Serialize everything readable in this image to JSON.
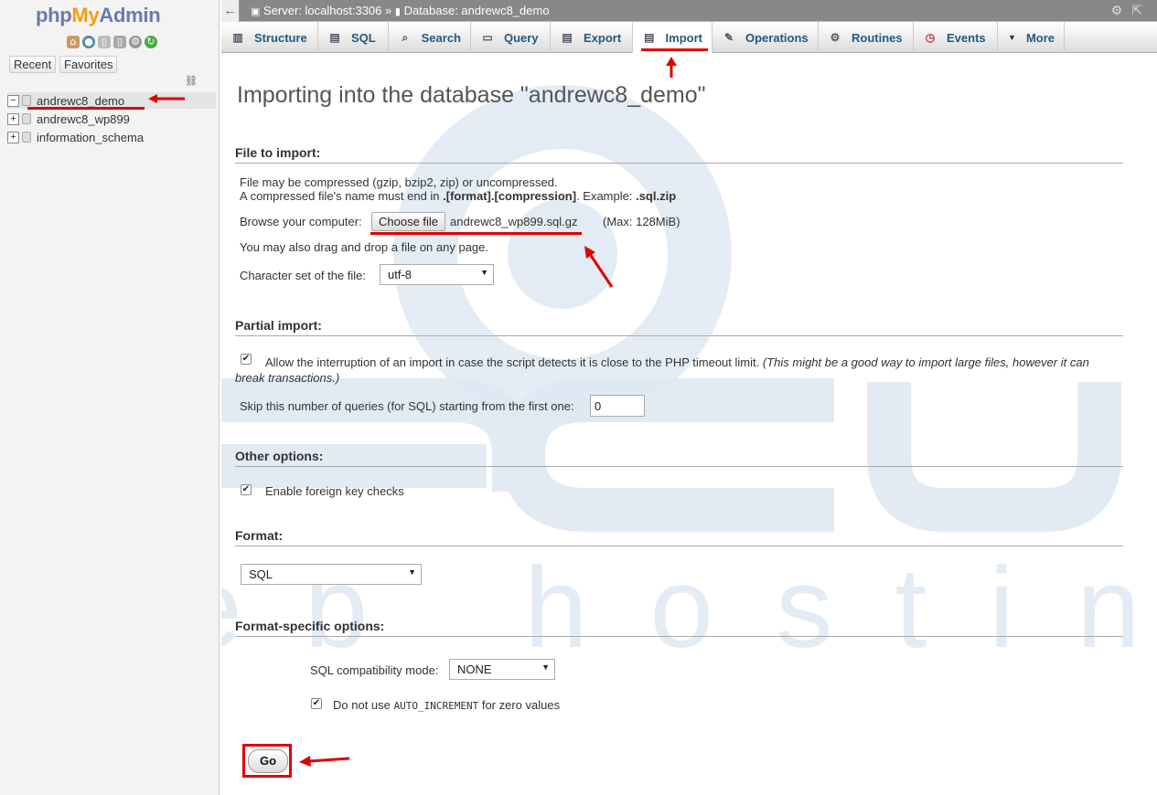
{
  "logo": {
    "php": "php",
    "my": "My",
    "admin": "Admin"
  },
  "sidebar": {
    "recent_label": "Recent",
    "favorites_label": "Favorites",
    "databases": [
      {
        "name": "andrewc8_demo",
        "expander": "−"
      },
      {
        "name": "andrewc8_wp899",
        "expander": "+"
      },
      {
        "name": "information_schema",
        "expander": "+"
      }
    ]
  },
  "topbar": {
    "back": "←",
    "server": "Server: localhost:3306",
    "separator": "»",
    "database": "Database: andrewc8_demo",
    "settings_icon": "⚙",
    "collapse_icon": "⇱"
  },
  "tabs": [
    {
      "label": "Structure",
      "icon": "structure-icon",
      "glyph": "▥"
    },
    {
      "label": "SQL",
      "icon": "sql-icon",
      "glyph": "▤"
    },
    {
      "label": "Search",
      "icon": "search-icon",
      "glyph": "⌕"
    },
    {
      "label": "Query",
      "icon": "query-icon",
      "glyph": "▭"
    },
    {
      "label": "Export",
      "icon": "export-icon",
      "glyph": "▤"
    },
    {
      "label": "Import",
      "icon": "import-icon",
      "glyph": "▤"
    },
    {
      "label": "Operations",
      "icon": "wrench-icon",
      "glyph": "✎"
    },
    {
      "label": "Routines",
      "icon": "routines-icon",
      "glyph": "⚙"
    },
    {
      "label": "Events",
      "icon": "clock-icon",
      "glyph": "◷"
    },
    {
      "label": "More",
      "icon": "caret-down-icon",
      "glyph": "▼"
    }
  ],
  "main": {
    "title": "Importing into the database \"andrewc8_demo\"",
    "file_section": "File to import:",
    "compress_line1": "File may be compressed (gzip, bzip2, zip) or uncompressed.",
    "compress_line2a": "A compressed file's name must end in ",
    "compress_line2b": ".[format].[compression]",
    "compress_line2c": ". Example: ",
    "compress_line2d": ".sql.zip",
    "browse_label": "Browse your computer:",
    "choose_file": "Choose file",
    "file_name": "andrewc8_wp899.sql.gz",
    "max_size": "(Max: 128MiB)",
    "drag_drop": "You may also drag and drop a file on any page.",
    "charset_label": "Character set of the file:",
    "charset_value": "utf-8",
    "partial_section": "Partial import:",
    "allow_interrupt": "Allow the interruption of an import in case the script detects it is close to the PHP timeout limit.",
    "allow_interrupt_note_1": "(This might be a good way to import large files, however it can",
    "allow_interrupt_note_2": "break transactions.)",
    "skip_label": "Skip this number of queries (for SQL) starting from the first one:",
    "skip_value": "0",
    "other_section": "Other options:",
    "foreign_keys": "Enable foreign key checks",
    "format_section": "Format:",
    "format_value": "SQL",
    "format_specific_section": "Format-specific options:",
    "compat_label": "SQL compatibility mode:",
    "compat_value": "NONE",
    "no_auto_a": "Do not use ",
    "no_auto_code": "AUTO_INCREMENT",
    "no_auto_b": " for zero values",
    "go": "Go"
  },
  "watermark": {
    "brand": "accu",
    "sub": "web hosting"
  },
  "colors": {
    "accent": "#235a81",
    "annotation": "#e00000"
  }
}
